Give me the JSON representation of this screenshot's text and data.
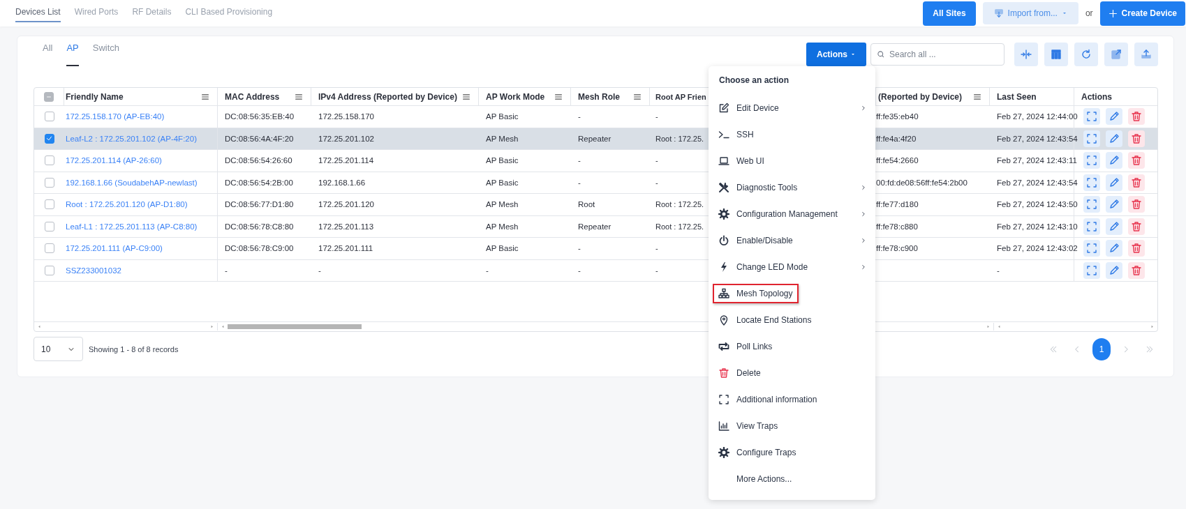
{
  "top_tabs": [
    {
      "label": "Devices List",
      "selected": true
    },
    {
      "label": "Wired Ports",
      "selected": false
    },
    {
      "label": "RF Details",
      "selected": false
    },
    {
      "label": "CLI Based Provisioning",
      "selected": false
    }
  ],
  "top_actions": [
    {
      "kind": "primary",
      "label": "All Sites"
    },
    {
      "kind": "dropdown",
      "label": "Import from..."
    },
    {
      "kind": "text",
      "label": "or"
    },
    {
      "kind": "create",
      "label": "Create Device"
    }
  ],
  "filter_tabs": [
    {
      "label": "All",
      "selected": false
    },
    {
      "label": "AP",
      "selected": true
    },
    {
      "label": "Switch",
      "selected": false
    }
  ],
  "toolbar": {
    "actions_button": "Actions",
    "search": {
      "placeholder": "Search all ..."
    }
  },
  "table": {
    "header_checkbox": {
      "indeterminate": true
    },
    "columns": [
      {
        "label": "Friendly Name",
        "menu": true
      },
      {
        "label": "MAC Address",
        "menu": true
      },
      {
        "label": "IPv4 Address (Reported by Device)",
        "menu": true
      },
      {
        "label": "AP Work Mode",
        "menu": true
      },
      {
        "label": "Mesh Role",
        "menu": true
      },
      {
        "label": "Root AP Frien",
        "menu": false
      },
      {
        "label": "(Reported by Device)",
        "menu": true
      },
      {
        "label": "Last Seen",
        "menu": false
      },
      {
        "label": "Actions",
        "menu": false
      }
    ],
    "rows": [
      {
        "selected": false,
        "checked": false,
        "name": "172.25.158.170 (AP-EB:40)",
        "mac": "DC:08:56:35:EB:40",
        "ipv4": "172.25.158.170",
        "work_mode": "AP Basic",
        "mesh_role": "-",
        "root_ap": "-",
        "ipv6": "ff:fe35:eb40",
        "last_seen": "Feb 27, 2024 12:44:00"
      },
      {
        "selected": true,
        "checked": true,
        "name": "Leaf-L2 : 172.25.201.102 (AP-4F:20)",
        "mac": "DC:08:56:4A:4F:20",
        "ipv4": "172.25.201.102",
        "work_mode": "AP Mesh",
        "mesh_role": "Repeater",
        "root_ap": "Root : 172.25.",
        "ipv6": "ff:fe4a:4f20",
        "last_seen": "Feb 27, 2024 12:43:54"
      },
      {
        "selected": false,
        "checked": false,
        "name": "172.25.201.114 (AP-26:60)",
        "mac": "DC:08:56:54:26:60",
        "ipv4": "172.25.201.114",
        "work_mode": "AP Basic",
        "mesh_role": "-",
        "root_ap": "-",
        "ipv6": "ff:fe54:2660",
        "last_seen": "Feb 27, 2024 12:43:11"
      },
      {
        "selected": false,
        "checked": false,
        "name": "192.168.1.66 (SoudabehAP-newlast)",
        "mac": "DC:08:56:54:2B:00",
        "ipv4": "192.168.1.66",
        "work_mode": "AP Basic",
        "mesh_role": "-",
        "root_ap": "-",
        "ipv6": "00:fd:de08:56ff:fe54:2b00",
        "last_seen": "Feb 27, 2024 12:43:54"
      },
      {
        "selected": false,
        "checked": false,
        "name": "Root : 172.25.201.120 (AP-D1:80)",
        "mac": "DC:08:56:77:D1:80",
        "ipv4": "172.25.201.120",
        "work_mode": "AP Mesh",
        "mesh_role": "Root",
        "root_ap": "Root : 172.25.",
        "ipv6": "ff:fe77:d180",
        "last_seen": "Feb 27, 2024 12:43:50"
      },
      {
        "selected": false,
        "checked": false,
        "name": "Leaf-L1 : 172.25.201.113 (AP-C8:80)",
        "mac": "DC:08:56:78:C8:80",
        "ipv4": "172.25.201.113",
        "work_mode": "AP Mesh",
        "mesh_role": "Repeater",
        "root_ap": "Root : 172.25.",
        "ipv6": "ff:fe78:c880",
        "last_seen": "Feb 27, 2024 12:43:10"
      },
      {
        "selected": false,
        "checked": false,
        "name": "172.25.201.111 (AP-C9:00)",
        "mac": "DC:08:56:78:C9:00",
        "ipv4": "172.25.201.111",
        "work_mode": "AP Basic",
        "mesh_role": "-",
        "root_ap": "-",
        "ipv6": "ff:fe78:c900",
        "last_seen": "Feb 27, 2024 12:43:02"
      },
      {
        "selected": false,
        "checked": false,
        "name": "SSZ233001032",
        "mac": "-",
        "ipv4": "-",
        "work_mode": "-",
        "mesh_role": "-",
        "root_ap": "-",
        "last_seen": "-"
      }
    ]
  },
  "footer": {
    "page_size": "10",
    "summary": "Showing 1 - 8 of 8 records",
    "pages": [
      {
        "label": "1",
        "selected": true
      }
    ]
  },
  "action_menu": {
    "title": "Choose an action",
    "items": [
      {
        "label": "Edit Device",
        "submenu": true,
        "highlighted": false
      },
      {
        "label": "SSH",
        "submenu": false,
        "highlighted": false
      },
      {
        "label": "Web UI",
        "submenu": false,
        "highlighted": false
      },
      {
        "label": "Diagnostic Tools",
        "submenu": true,
        "highlighted": false
      },
      {
        "label": "Configuration Management",
        "submenu": true,
        "highlighted": false
      },
      {
        "label": "Enable/Disable",
        "submenu": true,
        "highlighted": false
      },
      {
        "label": "Change LED Mode",
        "submenu": true,
        "highlighted": false
      },
      {
        "label": "Mesh Topology",
        "submenu": false,
        "highlighted": true
      },
      {
        "label": "Locate End Stations",
        "submenu": false,
        "highlighted": false
      },
      {
        "label": "Poll Links",
        "submenu": false,
        "highlighted": false
      },
      {
        "label": "Delete",
        "submenu": false,
        "highlighted": false
      },
      {
        "label": "Additional information",
        "submenu": false,
        "highlighted": false
      },
      {
        "label": "View Traps",
        "submenu": false,
        "highlighted": false
      },
      {
        "label": "Configure Traps",
        "submenu": false,
        "highlighted": false
      },
      {
        "label": "More Actions...",
        "submenu": false,
        "highlighted": false
      }
    ]
  }
}
